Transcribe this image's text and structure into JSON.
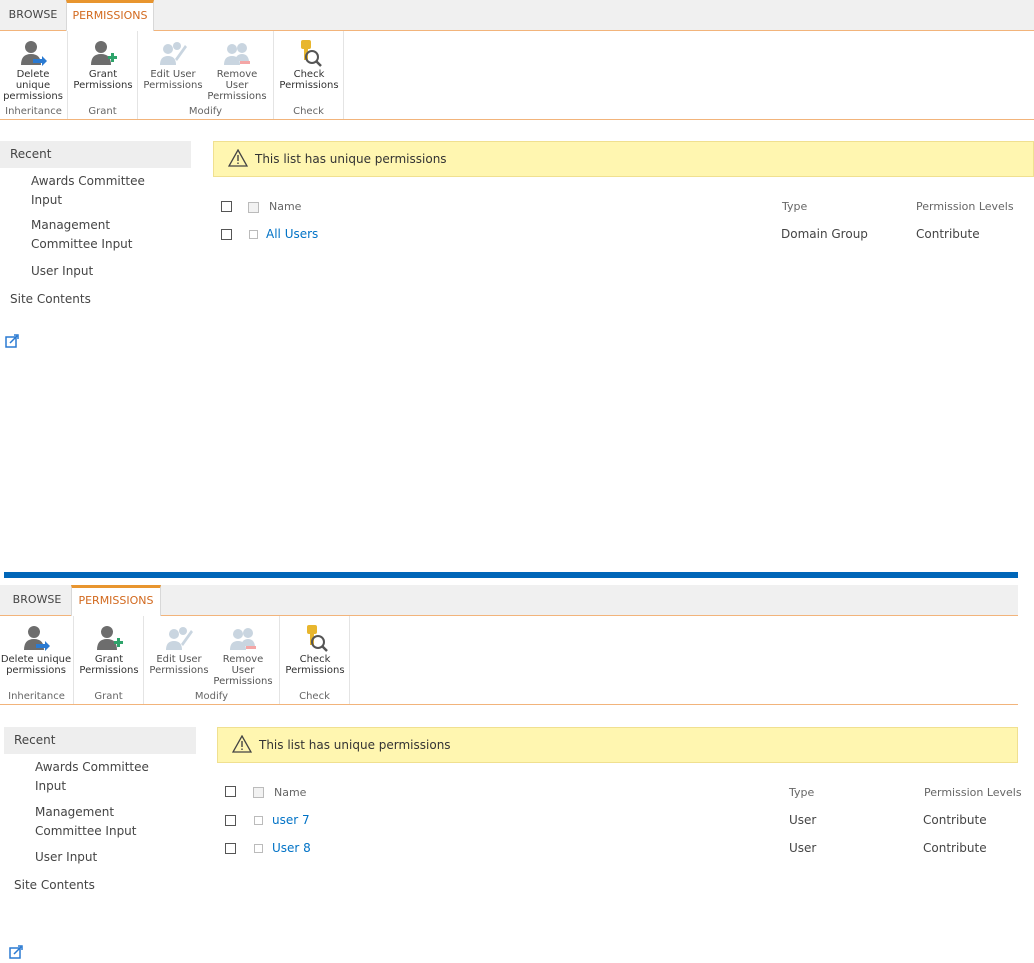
{
  "accent_color": "#e8952f",
  "link_color": "#0072c6",
  "separator_color": "#0066b8",
  "panels": [
    {
      "tabs": {
        "browse": "BROWSE",
        "permissions": "PERMISSIONS"
      },
      "ribbon": {
        "delete_unique": "Delete unique permissions",
        "grant": "Grant Permissions",
        "edit_user": "Edit User Permissions",
        "remove_user": "Remove User Permissions",
        "check": "Check Permissions",
        "group_inheritance": "Inheritance",
        "group_grant": "Grant",
        "group_modify": "Modify",
        "group_check": "Check"
      },
      "nav": {
        "recent": "Recent",
        "items": [
          "Awards Committee Input",
          "Management Committee Input",
          "User Input"
        ],
        "site_contents": "Site Contents"
      },
      "banner": "This list has unique permissions",
      "table": {
        "headers": {
          "name": "Name",
          "type": "Type",
          "levels": "Permission Levels"
        },
        "rows": [
          {
            "name": "All Users",
            "type": "Domain Group",
            "level": "Contribute"
          }
        ]
      }
    },
    {
      "tabs": {
        "browse": "BROWSE",
        "permissions": "PERMISSIONS"
      },
      "ribbon": {
        "delete_unique": "Delete unique permissions",
        "grant": "Grant Permissions",
        "edit_user": "Edit User Permissions",
        "remove_user": "Remove User Permissions",
        "check": "Check Permissions",
        "group_inheritance": "Inheritance",
        "group_grant": "Grant",
        "group_modify": "Modify",
        "group_check": "Check"
      },
      "nav": {
        "recent": "Recent",
        "items": [
          "Awards Committee Input",
          "Management Committee Input",
          "User Input"
        ],
        "site_contents": "Site Contents"
      },
      "banner": "This list has unique permissions",
      "table": {
        "headers": {
          "name": "Name",
          "type": "Type",
          "levels": "Permission Levels"
        },
        "rows": [
          {
            "name": "user 7",
            "type": "User",
            "level": "Contribute"
          },
          {
            "name": "User 8",
            "type": "User",
            "level": "Contribute"
          }
        ]
      }
    }
  ]
}
